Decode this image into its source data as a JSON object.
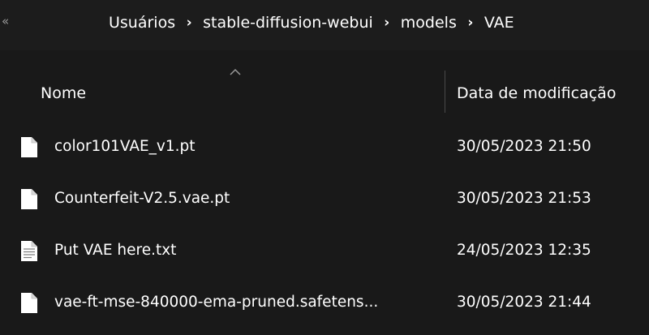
{
  "breadcrumb": {
    "overflow": "«",
    "items": [
      "Usuários",
      "stable-diffusion-webui",
      "models",
      "VAE"
    ],
    "separator": "›"
  },
  "columns": {
    "name": "Nome",
    "date": "Data de modificação"
  },
  "files": [
    {
      "name": "color101VAE_v1.pt",
      "date": "30/05/2023 21:50",
      "icon": "file-icon"
    },
    {
      "name": "Counterfeit-V2.5.vae.pt",
      "date": "30/05/2023 21:53",
      "icon": "file-icon"
    },
    {
      "name": "Put VAE here.txt",
      "date": "24/05/2023 12:35",
      "icon": "text-file-icon"
    },
    {
      "name": "vae-ft-mse-840000-ema-pruned.safetens...",
      "date": "30/05/2023 21:44",
      "icon": "file-icon"
    }
  ],
  "colors": {
    "background": "#191919",
    "text": "#ffffff"
  }
}
